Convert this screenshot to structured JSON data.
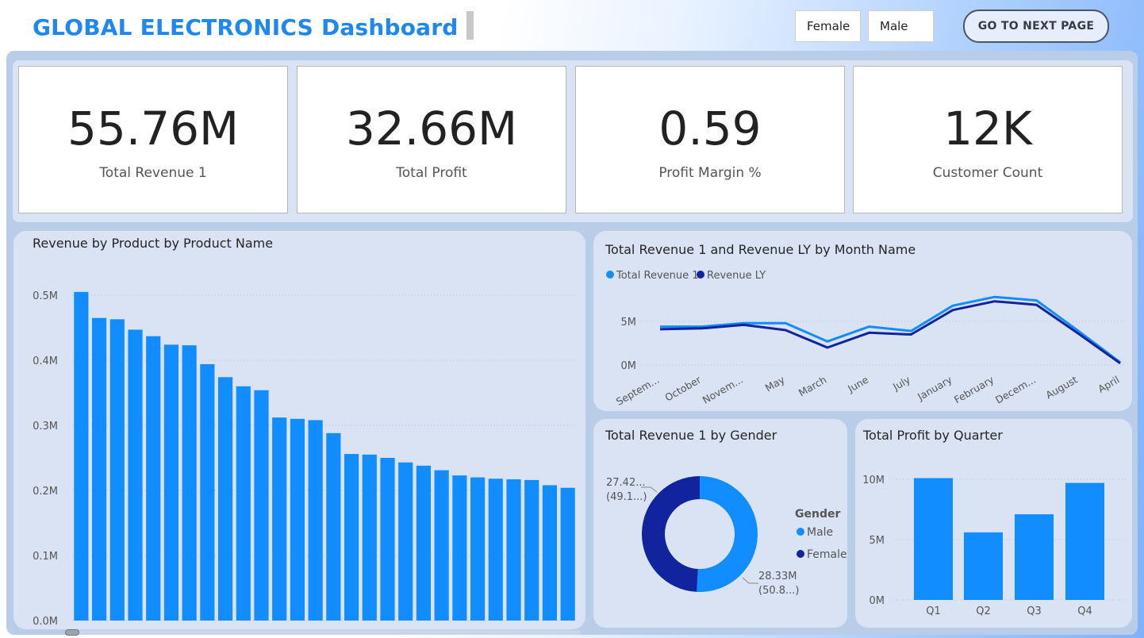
{
  "header": {
    "title": "GLOBAL ELECTRONICS Dashboard",
    "slicers": [
      "Female",
      "Male"
    ],
    "next_button": "GO TO NEXT PAGE"
  },
  "kpis": [
    {
      "value": "55.76M",
      "label": "Total Revenue 1"
    },
    {
      "value": "32.66M",
      "label": "Total Profit"
    },
    {
      "value": "0.59",
      "label": "Profit Margin %"
    },
    {
      "value": "12K",
      "label": "Customer Count"
    }
  ],
  "colors": {
    "light_blue": "#118dff",
    "dark_blue": "#12239e",
    "accent_title": "#1e87f0"
  },
  "chart_data": [
    {
      "type": "bar",
      "title": "Revenue by Product by Product Name",
      "yticks": [
        "0.0M",
        "0.1M",
        "0.2M",
        "0.3M",
        "0.4M",
        "0.5M"
      ],
      "ylim": [
        0,
        0.55
      ],
      "values": [
        0.505,
        0.465,
        0.463,
        0.447,
        0.437,
        0.424,
        0.423,
        0.394,
        0.374,
        0.36,
        0.354,
        0.312,
        0.31,
        0.308,
        0.288,
        0.256,
        0.255,
        0.25,
        0.243,
        0.238,
        0.231,
        0.223,
        0.22,
        0.218,
        0.217,
        0.216,
        0.208,
        0.204
      ],
      "color": "#118dff"
    },
    {
      "type": "line",
      "title": "Total Revenue 1 and Revenue LY by Month Name",
      "categories": [
        "Septem...",
        "October",
        "Novem...",
        "May",
        "March",
        "June",
        "July",
        "January",
        "February",
        "Decem...",
        "August",
        "April"
      ],
      "yticks": [
        "0M",
        "5M"
      ],
      "ylim": [
        0,
        5
      ],
      "series": [
        {
          "name": "Total Revenue 1",
          "color": "#118dff",
          "values": [
            4.4,
            4.4,
            4.8,
            4.8,
            2.7,
            4.4,
            3.9,
            6.8,
            7.8,
            7.4,
            3.9,
            0.3
          ]
        },
        {
          "name": "Revenue LY",
          "color": "#12239e",
          "values": [
            4.1,
            4.2,
            4.6,
            4.0,
            2.0,
            3.7,
            3.5,
            6.3,
            7.3,
            6.9,
            3.6,
            0.2
          ]
        }
      ]
    },
    {
      "type": "pie",
      "title": "Total Revenue 1 by Gender",
      "legend_title": "Gender",
      "slices": [
        {
          "name": "Male",
          "value": 28.33,
          "label": "28.33M",
          "pct_label": "(50.8...)",
          "color": "#118dff"
        },
        {
          "name": "Female",
          "value": 27.42,
          "label": "27.42...",
          "pct_label": "(49.1...)",
          "color": "#12239e"
        }
      ]
    },
    {
      "type": "bar",
      "title": "Total Profit by Quarter",
      "categories": [
        "Q1",
        "Q2",
        "Q3",
        "Q4"
      ],
      "values": [
        10.1,
        5.6,
        7.1,
        9.7
      ],
      "yticks": [
        "0M",
        "5M",
        "10M"
      ],
      "ylim": [
        0,
        10
      ],
      "color": "#118dff"
    }
  ]
}
